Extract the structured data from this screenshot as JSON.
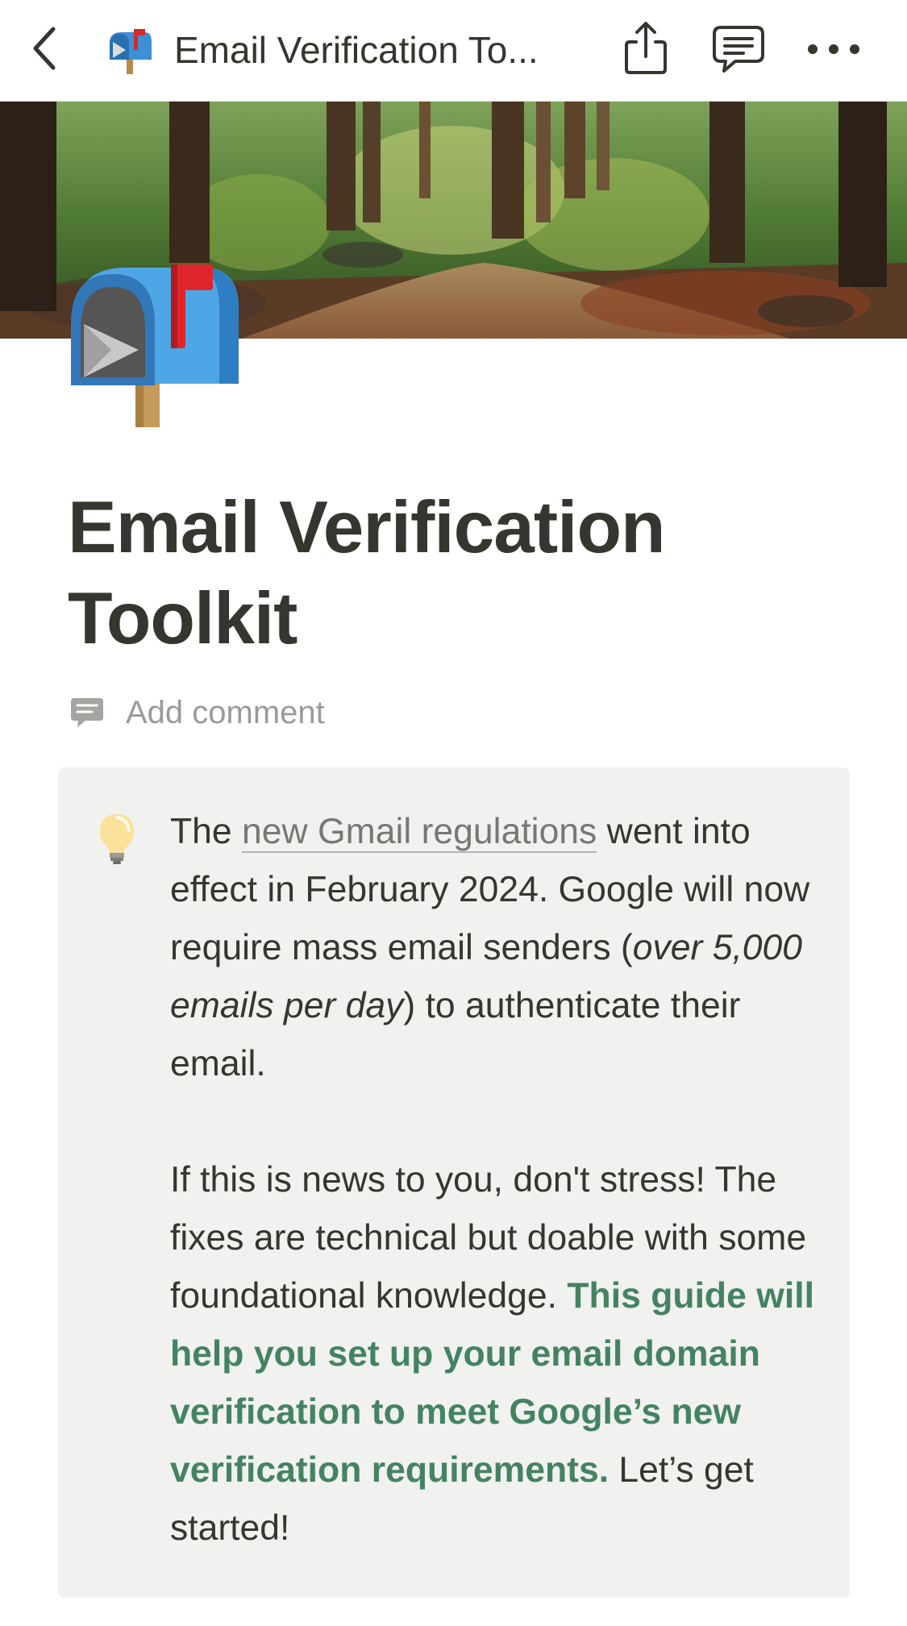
{
  "header": {
    "page_icon": "postbox-emoji",
    "title": "Email Verification To..."
  },
  "toolbar": {
    "back_icon": "chevron-left-icon",
    "share_icon": "share-icon",
    "comments_icon": "comments-icon",
    "more_icon": "more-horizontal-icon"
  },
  "page": {
    "cover": "forest-path-image",
    "icon": "postbox-emoji",
    "title_line1": "Email Verification",
    "title_line2": "Toolkit",
    "add_comment_label": "Add comment"
  },
  "callout": {
    "icon": "lightbulb-emoji",
    "p1": {
      "text_before_link": "The ",
      "link_text": "new Gmail regulations",
      "text_after_link": " went into effect in February 2024. Google will now require mass email senders (",
      "italic_text": "over 5,000 emails per day",
      "text_end": ") to authenticate their email."
    },
    "p2": {
      "text": "If this is news to you, don't stress! The fixes are technical but doable with some foundational knowledge. ",
      "highlight_text": "This guide will help you set up your email domain verification to meet Google’s new verification requirements.",
      "text_end": " Let’s get started!"
    }
  },
  "colors": {
    "text": "#37352f",
    "muted": "#9b9a97",
    "link": "#787774",
    "callout_bg": "#f1f1ef",
    "green_highlight": "#448361"
  }
}
